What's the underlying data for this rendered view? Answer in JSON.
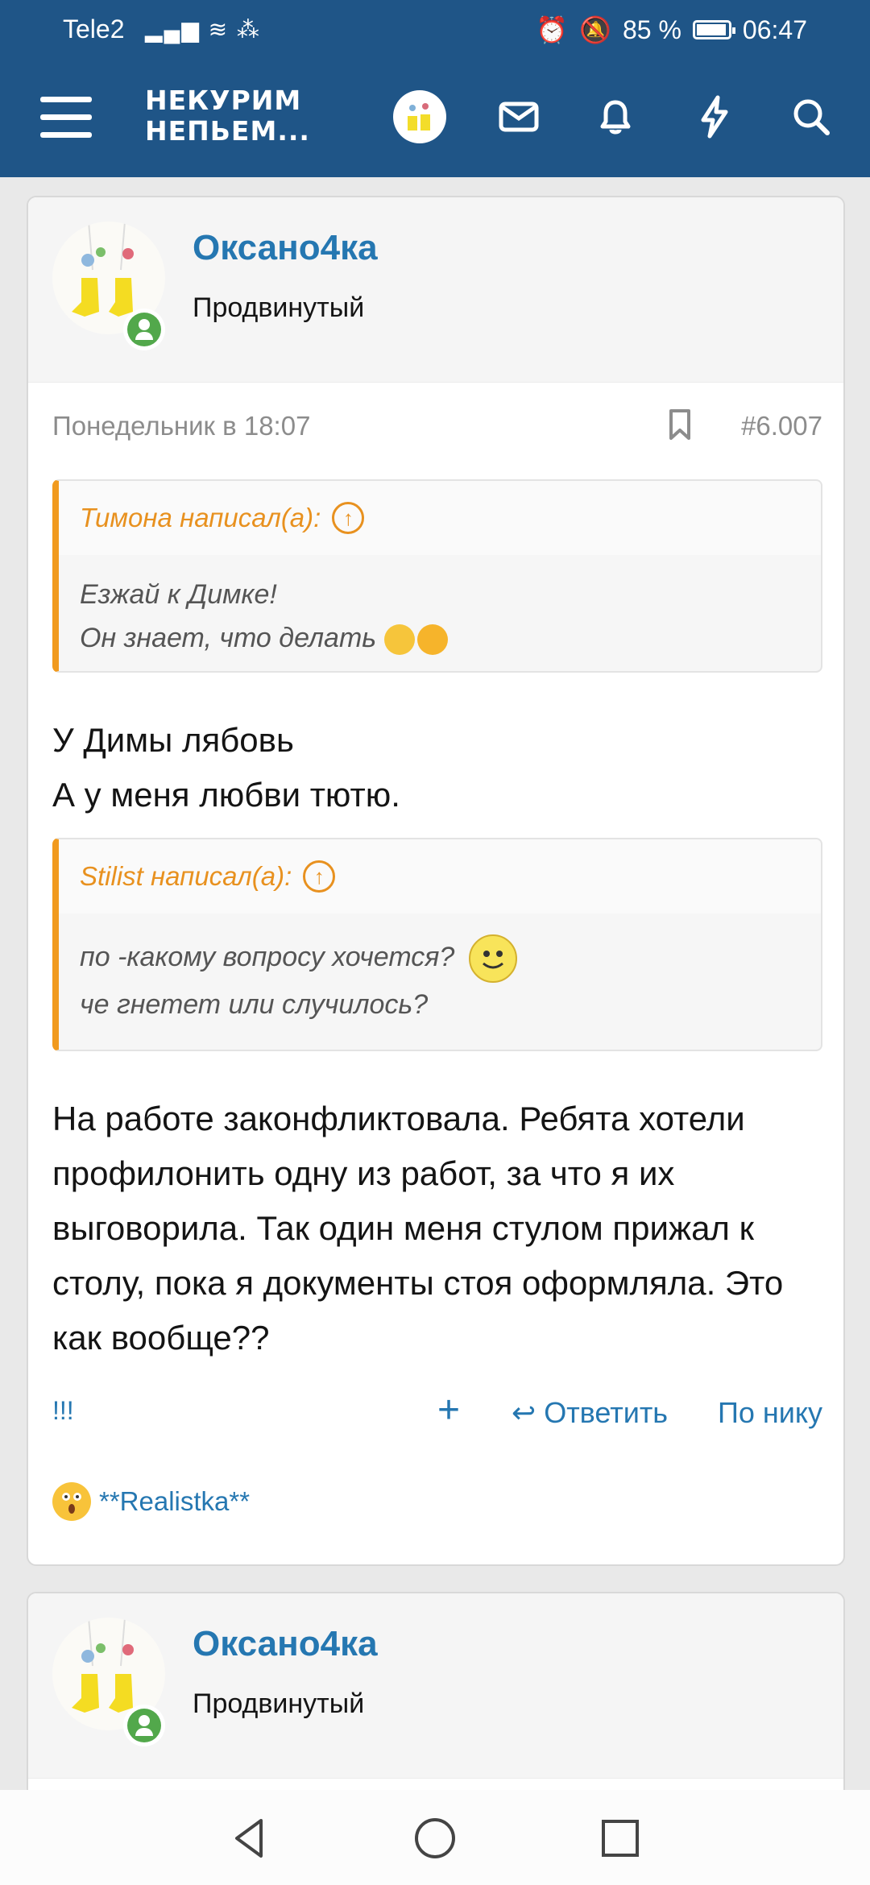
{
  "status_bar": {
    "carrier": "Tele2",
    "battery": "85 %",
    "battery_level": 0.85,
    "time": "06:47"
  },
  "header": {
    "logo_line1": "НЕКУРИМ",
    "logo_line2": "НЕПЬЕМ...",
    "icons": [
      "menu-icon",
      "avatar",
      "mail-icon",
      "bell-icon",
      "lightning-icon",
      "search-icon"
    ]
  },
  "post1": {
    "user": {
      "name": "Оксано4ка",
      "title": "Продвинутый"
    },
    "meta": {
      "date": "Понедельник в 18:07",
      "number": "#6.007"
    },
    "quote1": {
      "author": "Тимона написал(а):",
      "line1": "Езжай к Димке!",
      "line2": "Он знает, что делать"
    },
    "text1": {
      "line1": "У Димы лябовь",
      "line2": "А у меня любви тютю."
    },
    "quote2": {
      "author": "Stilist написал(а):",
      "line1": "по -какому вопросу хочется?",
      "line2": "че гнетет или случилось?"
    },
    "text2": "На работе законфликтовала. Ребята хотели профилонить одну из работ, за что я их выговорила. Так один меня стулом прижал к столу, пока я документы стоя оформляла. Это как вообще??",
    "actions": {
      "report": "!!!",
      "add": "+",
      "reply": "Ответить",
      "by_nick": "По нику"
    },
    "reaction_user": "**Realistka**"
  },
  "post2": {
    "user": {
      "name": "Оксано4ка",
      "title": "Продвинутый"
    }
  },
  "colors": {
    "header": "#1f5587",
    "link": "#2577b1",
    "quote_accent": "#f19a1e",
    "online": "#52a84b"
  }
}
